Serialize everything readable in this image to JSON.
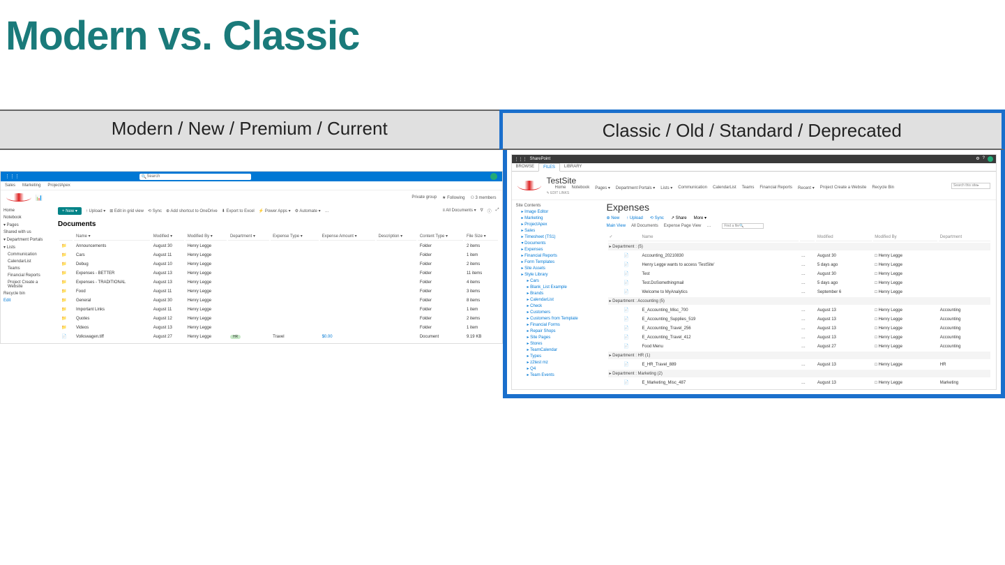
{
  "title": "Modern vs. Classic",
  "labels": {
    "left": "Modern / New / Premium / Current",
    "right": "Classic / Old / Standard / Deprecated"
  },
  "modern": {
    "search_placeholder": "Search",
    "tabs": [
      "Sales",
      "Marketing",
      "ProjectApex"
    ],
    "header_right": {
      "group": "Private group",
      "follow": "★ Following",
      "members": "⚇ 3 members"
    },
    "nav": [
      {
        "label": "Home"
      },
      {
        "label": "Notebook"
      },
      {
        "label": "Pages",
        "caret": true
      },
      {
        "label": "Shared with us"
      },
      {
        "label": "Department Portals",
        "caret": true
      },
      {
        "label": "Lists",
        "caret": true
      },
      {
        "label": "Communication",
        "indent": true
      },
      {
        "label": "CalendarList",
        "indent": true
      },
      {
        "label": "Teams",
        "indent": true
      },
      {
        "label": "Financial Reports",
        "indent": true
      },
      {
        "label": "Project Create a Website",
        "indent": true
      },
      {
        "label": "Recycle bin"
      },
      {
        "label": "Edit",
        "link": true
      }
    ],
    "toolbar": {
      "new": "+ New ▾",
      "items": [
        "↑ Upload ▾",
        "⊞ Edit in grid view",
        "⟲ Sync",
        "⊕ Add shortcut to OneDrive",
        "⬇ Export to Excel",
        "⚡ Power Apps ▾",
        "⚙ Automate ▾",
        "…"
      ],
      "right": [
        "≡ All Documents ▾",
        "∇",
        "ⓘ",
        "⤢"
      ]
    },
    "library_title": "Documents",
    "columns": [
      "",
      "Name ▾",
      "Modified ▾",
      "Modified By ▾",
      "Department ▾",
      "Expense Type ▾",
      "Expense Amount ▾",
      "Description ▾",
      "Content Type ▾",
      "File Size ▾"
    ],
    "rows": [
      {
        "icon": "folder",
        "name": "Announcements",
        "modified": "August 30",
        "by": "Henry Legge",
        "ct": "Folder",
        "size": "2 items"
      },
      {
        "icon": "folder",
        "name": "Cars",
        "modified": "August 11",
        "by": "Henry Legge",
        "ct": "Folder",
        "size": "1 item"
      },
      {
        "icon": "folder",
        "name": "Debug",
        "modified": "August 10",
        "by": "Henry Legge",
        "ct": "Folder",
        "size": "2 items"
      },
      {
        "icon": "folder",
        "name": "Expenses - BETTER",
        "modified": "August 13",
        "by": "Henry Legge",
        "ct": "Folder",
        "size": "11 items"
      },
      {
        "icon": "folder",
        "name": "Expenses - TRADITIONAL",
        "modified": "August 13",
        "by": "Henry Legge",
        "ct": "Folder",
        "size": "4 items"
      },
      {
        "icon": "folder",
        "name": "Food",
        "modified": "August 11",
        "by": "Henry Legge",
        "ct": "Folder",
        "size": "3 items"
      },
      {
        "icon": "folder",
        "name": "General",
        "modified": "August 30",
        "by": "Henry Legge",
        "ct": "Folder",
        "size": "8 items"
      },
      {
        "icon": "folder",
        "name": "Important Links",
        "modified": "August 11",
        "by": "Henry Legge",
        "ct": "Folder",
        "size": "1 item"
      },
      {
        "icon": "folder",
        "name": "Quotes",
        "modified": "August 12",
        "by": "Henry Legge",
        "ct": "Folder",
        "size": "2 items"
      },
      {
        "icon": "folder",
        "name": "Videos",
        "modified": "August 13",
        "by": "Henry Legge",
        "ct": "Folder",
        "size": "1 item"
      },
      {
        "icon": "file",
        "name": "Volkswagen.tiff",
        "modified": "August 27",
        "by": "Henry Legge",
        "dept": "HR",
        "etype": "Travel",
        "amount": "$0.00",
        "ct": "Document",
        "size": "9.19 KB"
      }
    ]
  },
  "classic": {
    "suite_label": "SharePoint",
    "ribbon_tabs": [
      "BROWSE",
      "FILES",
      "LIBRARY"
    ],
    "site_title": "TestSite",
    "edit_links": "✎ EDIT LINKS",
    "topnav": [
      "Home",
      "Notebook",
      "Pages ▾",
      "Department Portals ▾",
      "Lists ▾",
      "Communication",
      "CalendarList",
      "Teams",
      "Financial Reports",
      "Recent ▾",
      "Project Create a Website",
      "Recycle Bin"
    ],
    "search_placeholder": "Search this site",
    "leftnav_head": "Site Contents",
    "leftnav": [
      {
        "label": "Image Editor"
      },
      {
        "label": "Marketing"
      },
      {
        "label": "ProjectApex"
      },
      {
        "label": "Sales"
      },
      {
        "label": "Timesheet (TS1)"
      },
      {
        "label": "Documents",
        "expanded": true
      },
      {
        "label": "Expenses",
        "sub": true
      },
      {
        "label": "Financial Reports",
        "sub": true
      },
      {
        "label": "Form Templates",
        "sub": true
      },
      {
        "label": "Site Assets",
        "sub": true
      },
      {
        "label": "Style Library",
        "sub": true
      },
      {
        "label": "Cars",
        "sub2": true
      },
      {
        "label": "Blank_List Example",
        "sub2": true
      },
      {
        "label": "Brands",
        "sub2": true
      },
      {
        "label": "CalendarList",
        "sub2": true
      },
      {
        "label": "Check",
        "sub2": true
      },
      {
        "label": "Customers",
        "sub2": true
      },
      {
        "label": "Customers from Template",
        "sub2": true
      },
      {
        "label": "Financial Forms",
        "sub2": true
      },
      {
        "label": "Repair Shops",
        "sub2": true
      },
      {
        "label": "Site Pages",
        "sub2": true
      },
      {
        "label": "Stores",
        "sub2": true
      },
      {
        "label": "TeamCalendar",
        "sub2": true
      },
      {
        "label": "Types",
        "sub2": true
      },
      {
        "label": "z2test mz",
        "sub2": true
      },
      {
        "label": "Q4",
        "sub2": true
      },
      {
        "label": "Team Events",
        "sub2": true
      }
    ],
    "library_title": "Expenses",
    "toolbar": {
      "new": "⊕ New",
      "upload": "↑ Upload",
      "sync": "⟲ Sync",
      "share": "↗ Share",
      "more": "More ▾"
    },
    "views": [
      "Main View",
      "All Documents",
      "Expense Page View",
      "…"
    ],
    "find_placeholder": "Find a file",
    "columns": [
      "✓",
      "",
      "Name",
      "",
      "Modified",
      "Modified By",
      "Department"
    ],
    "groups": [
      {
        "header": "▸ Department :  (5)",
        "rows": [
          {
            "name": "Accounting_20210830",
            "modified": "August 30",
            "by": "Henry Legge"
          },
          {
            "name": "Henry Legge wants to access 'TestSite'",
            "modified": "5 days ago",
            "by": "Henry Legge"
          },
          {
            "name": "Test",
            "modified": "August 30",
            "by": "Henry Legge"
          },
          {
            "name": "Test.DoSomethingmail",
            "modified": "5 days ago",
            "by": "Henry Legge"
          },
          {
            "name": "Welcome to MyAnalytics",
            "modified": "September 6",
            "by": "Henry Legge"
          }
        ]
      },
      {
        "header": "▸ Department : Accounting (5)",
        "rows": [
          {
            "name": "E_Accounting_Misc_700",
            "modified": "August 13",
            "by": "Henry Legge",
            "dept": "Accounting"
          },
          {
            "name": "E_Accounting_Supplies_519",
            "modified": "August 13",
            "by": "Henry Legge",
            "dept": "Accounting"
          },
          {
            "name": "E_Accounting_Travel_256",
            "modified": "August 13",
            "by": "Henry Legge",
            "dept": "Accounting"
          },
          {
            "name": "E_Accounting_Travel_412",
            "modified": "August 13",
            "by": "Henry Legge",
            "dept": "Accounting"
          },
          {
            "name": "Food Menu",
            "modified": "August 27",
            "by": "Henry Legge",
            "dept": "Accounting"
          }
        ]
      },
      {
        "header": "▸ Department : HR (1)",
        "rows": [
          {
            "name": "E_HR_Travel_889",
            "modified": "August 13",
            "by": "Henry Legge",
            "dept": "HR"
          }
        ]
      },
      {
        "header": "▸ Department : Marketing (2)",
        "rows": [
          {
            "name": "E_Marketing_Misc_487",
            "modified": "August 13",
            "by": "Henry Legge",
            "dept": "Marketing"
          }
        ]
      }
    ]
  }
}
